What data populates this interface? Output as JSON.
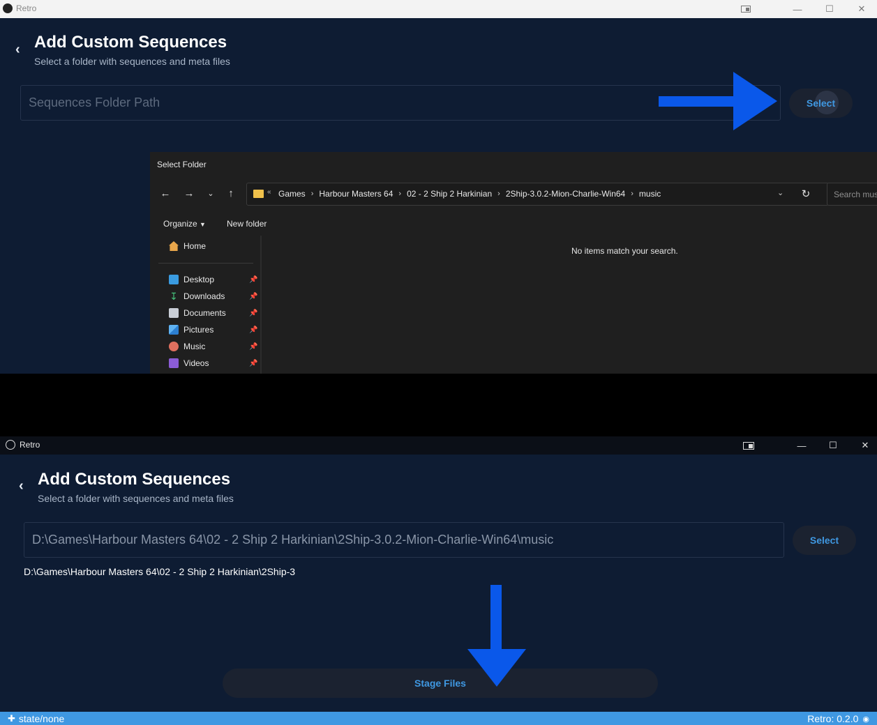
{
  "colors": {
    "page_bg": "#0e1c33",
    "accent": "#3f98e2",
    "annotation_arrow": "#0a58ea",
    "button_bg": "#1b2230",
    "dialog_bg": "#1f1f1f",
    "statusbar": "#3f98e2"
  },
  "top": {
    "window": {
      "title": "Retro"
    },
    "page": {
      "title": "Add Custom Sequences",
      "subtitle": "Select a folder with sequences and meta files",
      "path_placeholder": "Sequences Folder Path",
      "select_label": "Select"
    },
    "dialog": {
      "title": "Select Folder",
      "breadcrumbs": [
        "Games",
        "Harbour Masters 64",
        "02 - 2 Ship 2 Harkinian",
        "2Ship-3.0.2-Mion-Charlie-Win64",
        "music"
      ],
      "search_placeholder": "Search music",
      "organize_label": "Organize",
      "new_folder_label": "New folder",
      "nav": {
        "home": "Home",
        "desktop": "Desktop",
        "downloads": "Downloads",
        "documents": "Documents",
        "pictures": "Pictures",
        "music": "Music",
        "videos": "Videos"
      },
      "empty_message": "No items match your search."
    }
  },
  "bottom": {
    "window": {
      "title": "Retro"
    },
    "page": {
      "title": "Add Custom Sequences",
      "subtitle": "Select a folder with sequences and meta files",
      "path_value": "D:\\Games\\Harbour Masters 64\\02 - 2 Ship 2 Harkinian\\2Ship-3.0.2-Mion-Charlie-Win64\\music",
      "select_label": "Select",
      "selected_path_text": "D:\\Games\\Harbour Masters 64\\02 - 2 Ship 2 Harkinian\\2Ship-3",
      "stage_label": "Stage Files"
    },
    "status": {
      "state": "state/none",
      "version": "Retro: 0.2.0"
    }
  }
}
